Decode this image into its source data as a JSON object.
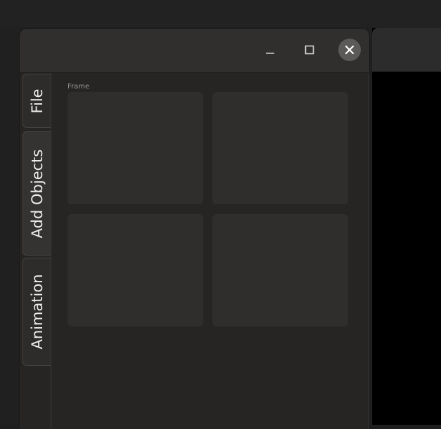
{
  "window": {
    "controls": {
      "minimize_icon": "minimize-icon",
      "maximize_icon": "maximize-icon",
      "close_icon": "close-icon"
    }
  },
  "tabs": [
    {
      "label": "File"
    },
    {
      "label": "Add Objects"
    },
    {
      "label": "Animation"
    }
  ],
  "content": {
    "frame_label": "Frame",
    "slots": [
      {},
      {},
      {},
      {}
    ]
  },
  "colors": {
    "desktop_bg": "#202020",
    "window_bg": "#262523",
    "titlebar_bg": "#302f2e",
    "tab_bg": "#2d2c2b",
    "slot_bg": "#2f2e2c",
    "close_button_bg": "#5b5a58"
  }
}
